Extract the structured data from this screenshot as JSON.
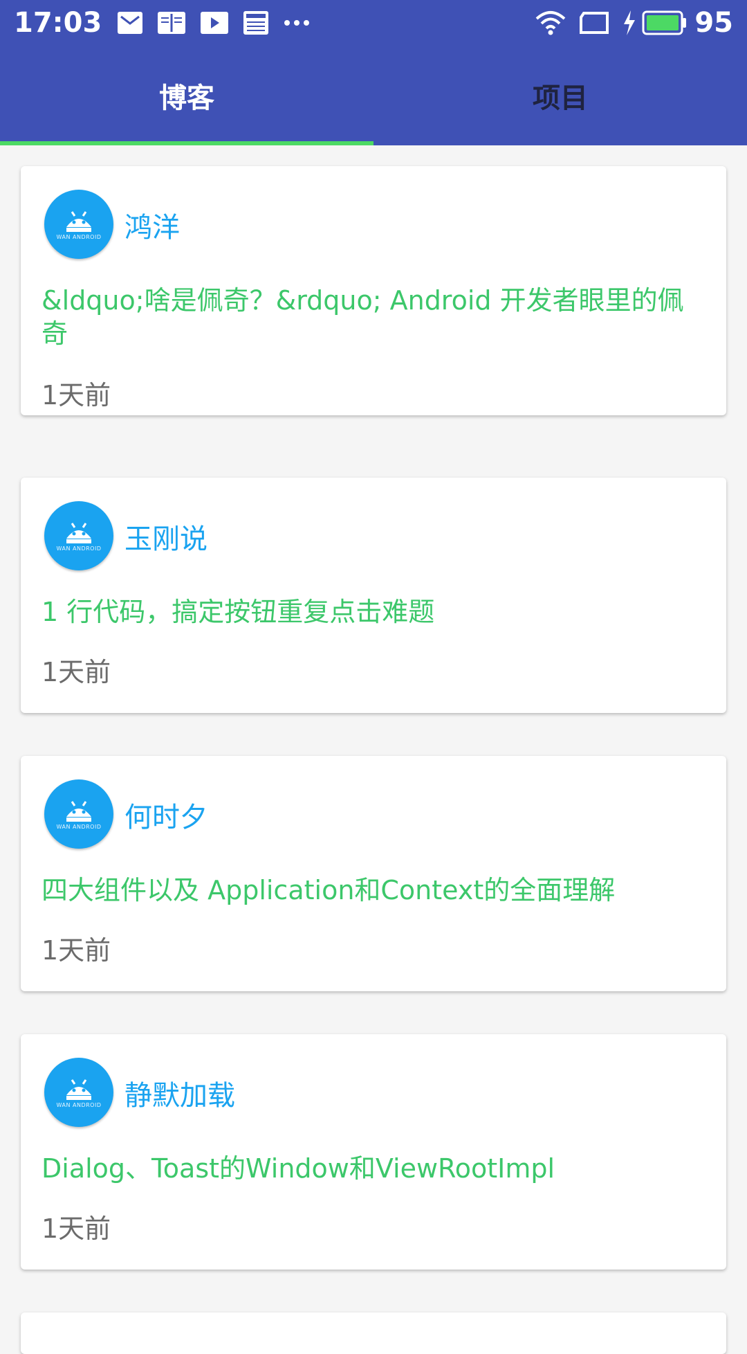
{
  "status_bar": {
    "time": "17:03",
    "battery": "95",
    "icons": [
      "mail-icon",
      "reader-icon",
      "video-icon",
      "news-icon",
      "more-dots-icon",
      "wifi-icon",
      "sim-icon",
      "charging-icon",
      "battery-icon"
    ]
  },
  "tabs": [
    {
      "label": "博客",
      "active": true
    },
    {
      "label": "项目",
      "active": false
    }
  ],
  "posts": [
    {
      "author": "鸿洋",
      "title": "&ldquo;啥是佩奇？&rdquo; Android 开发者眼里的佩奇",
      "time": "1天前"
    },
    {
      "author": "玉刚说",
      "title": "1 行代码，搞定按钮重复点击难题",
      "time": "1天前"
    },
    {
      "author": "何时夕",
      "title": "四大组件以及 Application和Context的全面理解",
      "time": "1天前"
    },
    {
      "author": "静默加载",
      "title": "Dialog、Toast的Window和ViewRootImpl",
      "time": "1天前"
    }
  ],
  "avatar_caption": "WAN ANDROID",
  "colors": {
    "primary": "#3f51b5",
    "indicator": "#4cd964",
    "author": "#1aa3f0",
    "title": "#3cc76a",
    "time": "#6b6b6b"
  }
}
